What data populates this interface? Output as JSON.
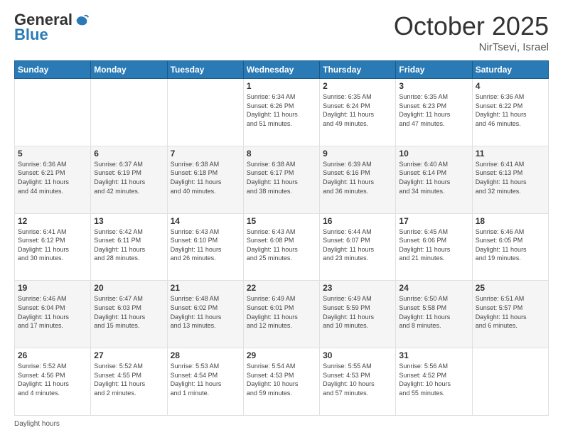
{
  "header": {
    "logo_general": "General",
    "logo_blue": "Blue",
    "month_title": "October 2025",
    "location": "NirTsevi, Israel"
  },
  "days_of_week": [
    "Sunday",
    "Monday",
    "Tuesday",
    "Wednesday",
    "Thursday",
    "Friday",
    "Saturday"
  ],
  "weeks": [
    [
      {
        "day": "",
        "info": ""
      },
      {
        "day": "",
        "info": ""
      },
      {
        "day": "",
        "info": ""
      },
      {
        "day": "1",
        "info": "Sunrise: 6:34 AM\nSunset: 6:26 PM\nDaylight: 11 hours\nand 51 minutes."
      },
      {
        "day": "2",
        "info": "Sunrise: 6:35 AM\nSunset: 6:24 PM\nDaylight: 11 hours\nand 49 minutes."
      },
      {
        "day": "3",
        "info": "Sunrise: 6:35 AM\nSunset: 6:23 PM\nDaylight: 11 hours\nand 47 minutes."
      },
      {
        "day": "4",
        "info": "Sunrise: 6:36 AM\nSunset: 6:22 PM\nDaylight: 11 hours\nand 46 minutes."
      }
    ],
    [
      {
        "day": "5",
        "info": "Sunrise: 6:36 AM\nSunset: 6:21 PM\nDaylight: 11 hours\nand 44 minutes."
      },
      {
        "day": "6",
        "info": "Sunrise: 6:37 AM\nSunset: 6:19 PM\nDaylight: 11 hours\nand 42 minutes."
      },
      {
        "day": "7",
        "info": "Sunrise: 6:38 AM\nSunset: 6:18 PM\nDaylight: 11 hours\nand 40 minutes."
      },
      {
        "day": "8",
        "info": "Sunrise: 6:38 AM\nSunset: 6:17 PM\nDaylight: 11 hours\nand 38 minutes."
      },
      {
        "day": "9",
        "info": "Sunrise: 6:39 AM\nSunset: 6:16 PM\nDaylight: 11 hours\nand 36 minutes."
      },
      {
        "day": "10",
        "info": "Sunrise: 6:40 AM\nSunset: 6:14 PM\nDaylight: 11 hours\nand 34 minutes."
      },
      {
        "day": "11",
        "info": "Sunrise: 6:41 AM\nSunset: 6:13 PM\nDaylight: 11 hours\nand 32 minutes."
      }
    ],
    [
      {
        "day": "12",
        "info": "Sunrise: 6:41 AM\nSunset: 6:12 PM\nDaylight: 11 hours\nand 30 minutes."
      },
      {
        "day": "13",
        "info": "Sunrise: 6:42 AM\nSunset: 6:11 PM\nDaylight: 11 hours\nand 28 minutes."
      },
      {
        "day": "14",
        "info": "Sunrise: 6:43 AM\nSunset: 6:10 PM\nDaylight: 11 hours\nand 26 minutes."
      },
      {
        "day": "15",
        "info": "Sunrise: 6:43 AM\nSunset: 6:08 PM\nDaylight: 11 hours\nand 25 minutes."
      },
      {
        "day": "16",
        "info": "Sunrise: 6:44 AM\nSunset: 6:07 PM\nDaylight: 11 hours\nand 23 minutes."
      },
      {
        "day": "17",
        "info": "Sunrise: 6:45 AM\nSunset: 6:06 PM\nDaylight: 11 hours\nand 21 minutes."
      },
      {
        "day": "18",
        "info": "Sunrise: 6:46 AM\nSunset: 6:05 PM\nDaylight: 11 hours\nand 19 minutes."
      }
    ],
    [
      {
        "day": "19",
        "info": "Sunrise: 6:46 AM\nSunset: 6:04 PM\nDaylight: 11 hours\nand 17 minutes."
      },
      {
        "day": "20",
        "info": "Sunrise: 6:47 AM\nSunset: 6:03 PM\nDaylight: 11 hours\nand 15 minutes."
      },
      {
        "day": "21",
        "info": "Sunrise: 6:48 AM\nSunset: 6:02 PM\nDaylight: 11 hours\nand 13 minutes."
      },
      {
        "day": "22",
        "info": "Sunrise: 6:49 AM\nSunset: 6:01 PM\nDaylight: 11 hours\nand 12 minutes."
      },
      {
        "day": "23",
        "info": "Sunrise: 6:49 AM\nSunset: 5:59 PM\nDaylight: 11 hours\nand 10 minutes."
      },
      {
        "day": "24",
        "info": "Sunrise: 6:50 AM\nSunset: 5:58 PM\nDaylight: 11 hours\nand 8 minutes."
      },
      {
        "day": "25",
        "info": "Sunrise: 6:51 AM\nSunset: 5:57 PM\nDaylight: 11 hours\nand 6 minutes."
      }
    ],
    [
      {
        "day": "26",
        "info": "Sunrise: 5:52 AM\nSunset: 4:56 PM\nDaylight: 11 hours\nand 4 minutes."
      },
      {
        "day": "27",
        "info": "Sunrise: 5:52 AM\nSunset: 4:55 PM\nDaylight: 11 hours\nand 2 minutes."
      },
      {
        "day": "28",
        "info": "Sunrise: 5:53 AM\nSunset: 4:54 PM\nDaylight: 11 hours\nand 1 minute."
      },
      {
        "day": "29",
        "info": "Sunrise: 5:54 AM\nSunset: 4:53 PM\nDaylight: 10 hours\nand 59 minutes."
      },
      {
        "day": "30",
        "info": "Sunrise: 5:55 AM\nSunset: 4:53 PM\nDaylight: 10 hours\nand 57 minutes."
      },
      {
        "day": "31",
        "info": "Sunrise: 5:56 AM\nSunset: 4:52 PM\nDaylight: 10 hours\nand 55 minutes."
      },
      {
        "day": "",
        "info": ""
      }
    ]
  ],
  "footer": {
    "label": "Daylight hours"
  }
}
